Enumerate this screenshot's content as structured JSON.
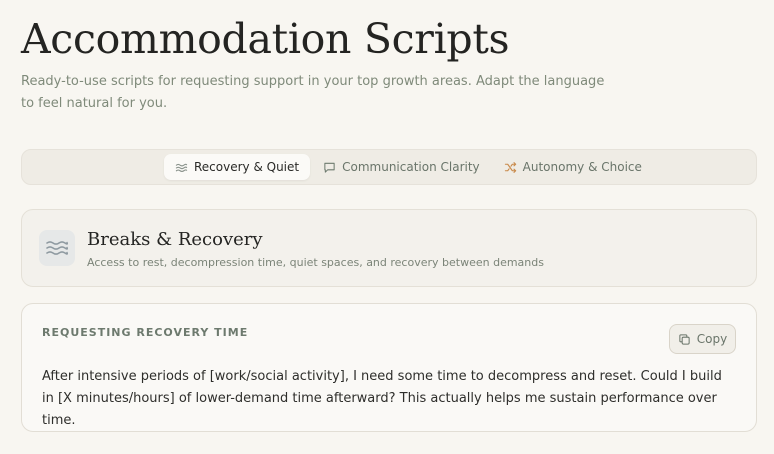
{
  "header": {
    "title": "Accommodation Scripts",
    "subtitle": "Ready-to-use scripts for requesting support in your top growth areas. Adapt the language to feel natural for you."
  },
  "tabs": [
    {
      "label": "Recovery & Quiet",
      "icon": "waves-icon",
      "active": true
    },
    {
      "label": "Communication Clarity",
      "icon": "message-square-icon",
      "active": false
    },
    {
      "label": "Autonomy & Choice",
      "icon": "shuffle-icon",
      "active": false
    }
  ],
  "category": {
    "icon": "waves-icon",
    "title": "Breaks & Recovery",
    "description": "Access to rest, decompression time, quiet spaces, and recovery between demands"
  },
  "script": {
    "heading": "REQUESTING RECOVERY TIME",
    "copy_label": "Copy",
    "copy_icon": "copy-icon",
    "text": "After intensive periods of [work/social activity], I need some time to decompress and reset. Could I build in [X minutes/hours] of lower-demand time afterward? This actually helps me sustain performance over time."
  },
  "colors": {
    "background": "#f8f6f1",
    "accent_green": "#6d7a6e",
    "accent_orange": "#c98a4b"
  }
}
